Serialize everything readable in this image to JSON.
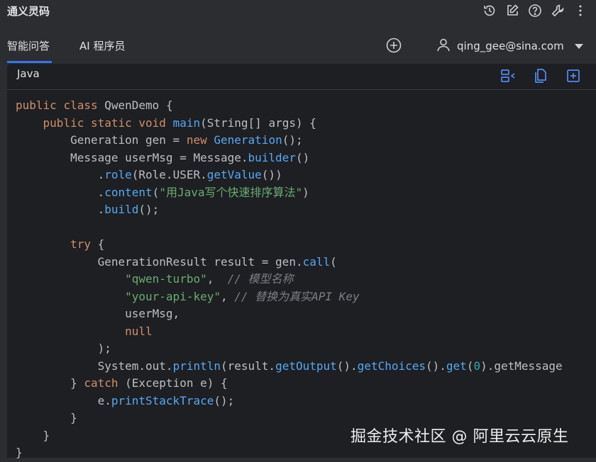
{
  "app": {
    "title": "通义灵码"
  },
  "title_tools": [
    "history-icon",
    "edit-icon",
    "help-icon",
    "settings-wrench-icon",
    "more-vertical-icon"
  ],
  "tabs": [
    {
      "label": "智能问答",
      "active": true
    },
    {
      "label": "AI 程序员",
      "active": false
    }
  ],
  "account": {
    "email": "qing_gee@sina.com"
  },
  "code_block": {
    "language": "Java",
    "lines": [
      "public class QwenDemo {",
      "    public static void main(String[] args) {",
      "        Generation gen = new Generation();",
      "        Message userMsg = Message.builder()",
      "            .role(Role.USER.getValue())",
      "            .content(\"用Java写个快速排序算法\")",
      "            .build();",
      "",
      "        try {",
      "            GenerationResult result = gen.call(",
      "                \"qwen-turbo\",  // 模型名称",
      "                \"your-api-key\", // 替换为真实API Key",
      "                userMsg,",
      "                null",
      "            );",
      "            System.out.println(result.getOutput().getChoices().get(0).getMessage",
      "        } catch (Exception e) {",
      "            e.printStackTrace();",
      "        }",
      "    }",
      "}"
    ]
  },
  "watermark": "掘金技术社区 @ 阿里云云原生",
  "colors": {
    "background": "#2b2d30",
    "editor_bg": "#1e1f22",
    "accent": "#3574f0",
    "keyword": "#cf8e6d",
    "function": "#56a8f5",
    "string": "#6aab73",
    "comment": "#7a7e85"
  }
}
